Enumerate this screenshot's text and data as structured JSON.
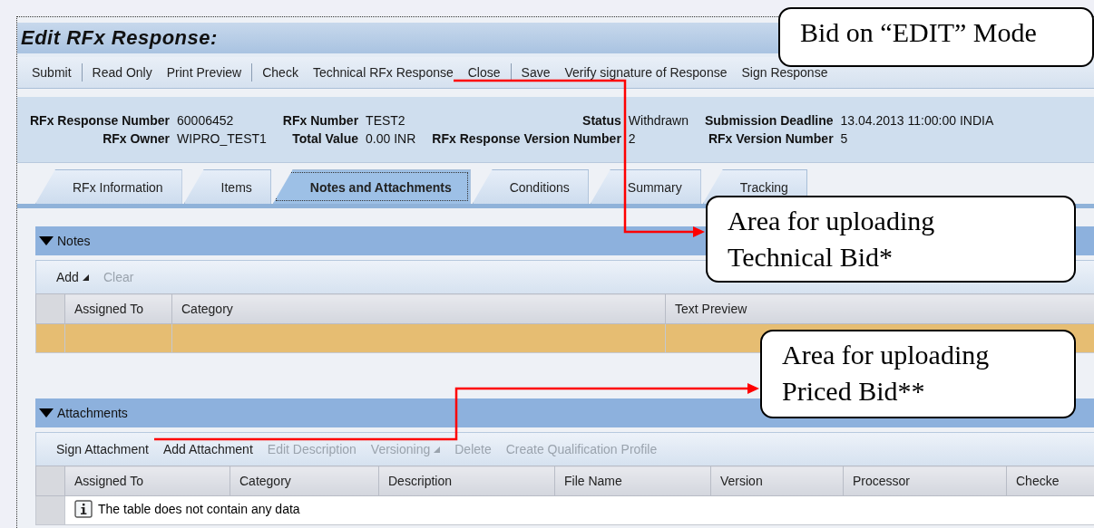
{
  "window": {
    "title": "Edit RFx Response:"
  },
  "toolbar": {
    "groups": [
      [
        "Submit"
      ],
      [
        "Read Only",
        "Print Preview"
      ],
      [
        "Check",
        "Technical RFx Response",
        "Close"
      ],
      [
        "Save",
        "Verify signature of Response",
        "Sign Response"
      ]
    ]
  },
  "header_fields": [
    {
      "label": "RFx Response Number",
      "value": "60006452"
    },
    {
      "label": "RFx Number",
      "value": "TEST2"
    },
    {
      "label": "Status",
      "value": "Withdrawn"
    },
    {
      "label": "Submission Deadline",
      "value": "13.04.2013 11:00:00 INDIA"
    },
    {
      "label": "RFx Owner",
      "value": "WIPRO_TEST1"
    },
    {
      "label": "Total Value",
      "value": "0.00 INR"
    },
    {
      "label": "RFx Response Version Number",
      "value": "2"
    },
    {
      "label": "RFx Version Number",
      "value": "5"
    }
  ],
  "tabs": [
    {
      "label": "RFx Information",
      "selected": false
    },
    {
      "label": "Items",
      "selected": false
    },
    {
      "label": "Notes and Attachments",
      "selected": true
    },
    {
      "label": "Conditions",
      "selected": false
    },
    {
      "label": "Summary",
      "selected": false
    },
    {
      "label": "Tracking",
      "selected": false
    }
  ],
  "notes": {
    "title": "Notes",
    "expanded": true,
    "actions": [
      {
        "label": "Add",
        "disabled": false,
        "menu": true
      },
      {
        "label": "Clear",
        "disabled": true,
        "menu": false
      }
    ],
    "columns": [
      "Assigned To",
      "Category",
      "Text Preview"
    ],
    "rows": [
      {
        "selected": true
      }
    ]
  },
  "attachments": {
    "title": "Attachments",
    "expanded": true,
    "actions": [
      {
        "label": "Sign Attachment",
        "disabled": false,
        "menu": false
      },
      {
        "label": "Add Attachment",
        "disabled": false,
        "menu": false
      },
      {
        "label": "Edit Description",
        "disabled": true,
        "menu": false
      },
      {
        "label": "Versioning",
        "disabled": true,
        "menu": true
      },
      {
        "label": "Delete",
        "disabled": true,
        "menu": false
      },
      {
        "label": "Create Qualification Profile",
        "disabled": true,
        "menu": false
      }
    ],
    "columns": [
      "Assigned To",
      "Category",
      "Description",
      "File Name",
      "Version",
      "Processor",
      "Checke"
    ],
    "empty_message": "The table does not contain any data"
  },
  "callouts": [
    "Bid on “EDIT” Mode",
    "Area for uploading Technical Bid*",
    "Area for uploading Priced Bid**"
  ]
}
